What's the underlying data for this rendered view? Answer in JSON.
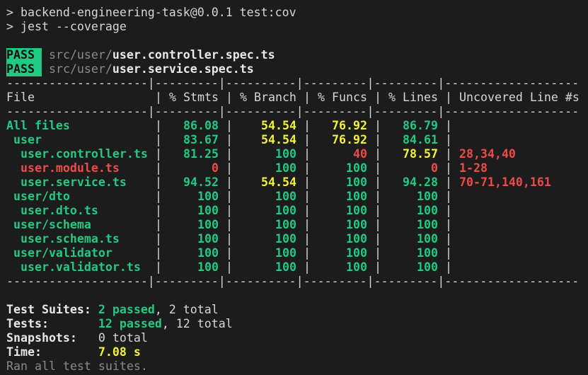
{
  "command": {
    "line1": "> backend-engineering-task@0.0.1 test:cov",
    "line2": "> jest --coverage"
  },
  "tests": [
    {
      "status": "PASS",
      "dir": "src/user/",
      "file": "user.controller.spec.ts"
    },
    {
      "status": "PASS",
      "dir": "src/user/",
      "file": "user.service.spec.ts"
    }
  ],
  "separator": "--------------------|---------|----------|---------|---------|-------------------",
  "headers": {
    "file": "File",
    "stmts": "% Stmts",
    "branch": "% Branch",
    "funcs": "% Funcs",
    "lines": "% Lines",
    "uncovered": "Uncovered Line #s"
  },
  "rows": [
    {
      "name": "All files",
      "stmts": "86.08",
      "branch": "54.54",
      "funcs": "76.92",
      "lines": "86.79",
      "uncovered": "",
      "colors": {
        "name": "#22c983",
        "stmts": "#22c983",
        "branch": "#f2f23c",
        "funcs": "#f2f23c",
        "lines": "#22c983",
        "uncovered": "#22c983"
      }
    },
    {
      "name": " user",
      "stmts": "83.67",
      "branch": "54.54",
      "funcs": "76.92",
      "lines": "84.61",
      "uncovered": "",
      "colors": {
        "name": "#22c983",
        "stmts": "#22c983",
        "branch": "#f2f23c",
        "funcs": "#f2f23c",
        "lines": "#22c983",
        "uncovered": "#22c983"
      }
    },
    {
      "name": "  user.controller.ts",
      "stmts": "81.25",
      "branch": "100",
      "funcs": "40",
      "lines": "78.57",
      "uncovered": "28,34,40",
      "colors": {
        "name": "#22c983",
        "stmts": "#22c983",
        "branch": "#22c983",
        "funcs": "#ee4b4b",
        "lines": "#f2f23c",
        "uncovered": "#ee4b4b"
      }
    },
    {
      "name": "  user.module.ts",
      "stmts": "0",
      "branch": "100",
      "funcs": "100",
      "lines": "0",
      "uncovered": "1-28",
      "colors": {
        "name": "#ee4b4b",
        "stmts": "#ee4b4b",
        "branch": "#22c983",
        "funcs": "#22c983",
        "lines": "#ee4b4b",
        "uncovered": "#ee4b4b"
      }
    },
    {
      "name": "  user.service.ts",
      "stmts": "94.52",
      "branch": "54.54",
      "funcs": "100",
      "lines": "94.28",
      "uncovered": "70-71,140,161",
      "colors": {
        "name": "#22c983",
        "stmts": "#22c983",
        "branch": "#f2f23c",
        "funcs": "#22c983",
        "lines": "#22c983",
        "uncovered": "#ee4b4b"
      }
    },
    {
      "name": " user/dto",
      "stmts": "100",
      "branch": "100",
      "funcs": "100",
      "lines": "100",
      "uncovered": "",
      "colors": {
        "name": "#22c983",
        "stmts": "#22c983",
        "branch": "#22c983",
        "funcs": "#22c983",
        "lines": "#22c983",
        "uncovered": "#22c983"
      }
    },
    {
      "name": "  user.dto.ts",
      "stmts": "100",
      "branch": "100",
      "funcs": "100",
      "lines": "100",
      "uncovered": "",
      "colors": {
        "name": "#22c983",
        "stmts": "#22c983",
        "branch": "#22c983",
        "funcs": "#22c983",
        "lines": "#22c983",
        "uncovered": "#22c983"
      }
    },
    {
      "name": " user/schema",
      "stmts": "100",
      "branch": "100",
      "funcs": "100",
      "lines": "100",
      "uncovered": "",
      "colors": {
        "name": "#22c983",
        "stmts": "#22c983",
        "branch": "#22c983",
        "funcs": "#22c983",
        "lines": "#22c983",
        "uncovered": "#22c983"
      }
    },
    {
      "name": "  user.schema.ts",
      "stmts": "100",
      "branch": "100",
      "funcs": "100",
      "lines": "100",
      "uncovered": "",
      "colors": {
        "name": "#22c983",
        "stmts": "#22c983",
        "branch": "#22c983",
        "funcs": "#22c983",
        "lines": "#22c983",
        "uncovered": "#22c983"
      }
    },
    {
      "name": " user/validator",
      "stmts": "100",
      "branch": "100",
      "funcs": "100",
      "lines": "100",
      "uncovered": "",
      "colors": {
        "name": "#22c983",
        "stmts": "#22c983",
        "branch": "#22c983",
        "funcs": "#22c983",
        "lines": "#22c983",
        "uncovered": "#22c983"
      }
    },
    {
      "name": "  user.validator.ts",
      "stmts": "100",
      "branch": "100",
      "funcs": "100",
      "lines": "100",
      "uncovered": "",
      "colors": {
        "name": "#22c983",
        "stmts": "#22c983",
        "branch": "#22c983",
        "funcs": "#22c983",
        "lines": "#22c983",
        "uncovered": "#22c983"
      }
    }
  ],
  "summary": {
    "suites_label": "Test Suites:",
    "suites_passed": "2 passed",
    "suites_total": ", 2 total",
    "tests_label": "Tests:",
    "tests_passed": "12 passed",
    "tests_total": ", 12 total",
    "snapshots_label": "Snapshots:",
    "snapshots_value": "0 total",
    "time_label": "Time:",
    "time_value": "7.08 s",
    "footer": "Ran all test suites."
  },
  "colors": {
    "background": "#1c1c1c",
    "text": "#d6d6d6",
    "green": "#22c983",
    "yellow": "#f2f23c",
    "red": "#ee4b4b",
    "dim": "#8a8a8a"
  }
}
